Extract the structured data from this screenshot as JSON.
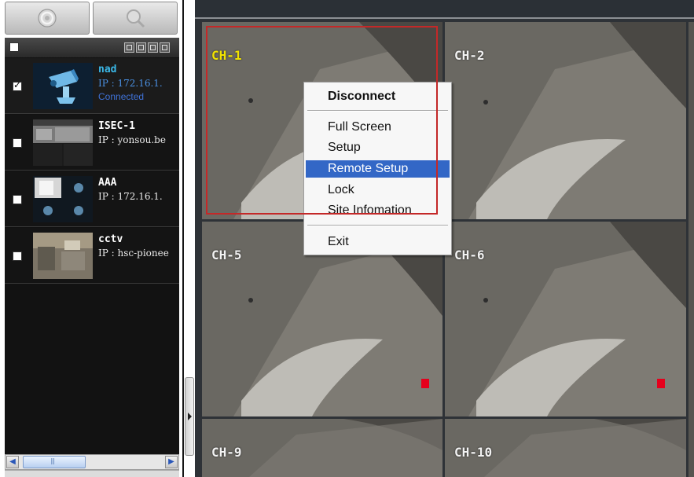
{
  "toolbar": {
    "buttons": [
      {
        "icon": "gear-icon"
      },
      {
        "icon": "zoom-icon"
      }
    ]
  },
  "site_list": {
    "header_icons": [
      "layout-icon",
      "layout-icon",
      "layout-icon",
      "layout-icon"
    ],
    "sites": [
      {
        "name": "nad",
        "ip": "IP : 172.16.1.",
        "status": "Connected",
        "checked": true
      },
      {
        "name": "ISEC-1",
        "ip": "IP : yonsou.be",
        "status": "",
        "checked": false
      },
      {
        "name": "AAA",
        "ip": "IP : 172.16.1.",
        "status": "",
        "checked": false
      },
      {
        "name": "cctv",
        "ip": "IP : hsc-pionee",
        "status": "",
        "checked": false
      }
    ]
  },
  "channels": [
    {
      "label": "CH-1",
      "selected": true,
      "rec": true
    },
    {
      "label": "CH-2",
      "selected": false,
      "rec": false
    },
    {
      "label": "CH-5",
      "selected": false,
      "rec": true
    },
    {
      "label": "CH-6",
      "selected": false,
      "rec": true
    },
    {
      "label": "CH-9",
      "selected": false,
      "rec": false
    },
    {
      "label": "CH-10",
      "selected": false,
      "rec": false
    }
  ],
  "context_menu": {
    "items": [
      {
        "label": "Disconnect",
        "bold": true
      },
      {
        "label": "Full Screen"
      },
      {
        "label": "Setup"
      },
      {
        "label": "Remote Setup",
        "highlighted": true
      },
      {
        "label": "Lock"
      },
      {
        "label": "Site Infomation"
      },
      {
        "label": "Exit"
      }
    ]
  },
  "colors": {
    "selected_channel_label": "#f1e300",
    "selection_border": "#c42828",
    "menu_highlight": "#3367c6",
    "connected_site_name": "#3ab8e8",
    "record_marker": "#e5001c"
  }
}
